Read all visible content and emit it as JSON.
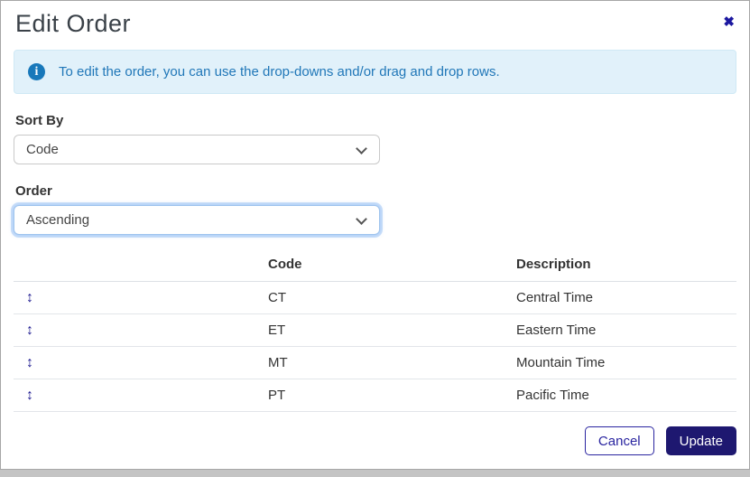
{
  "modal": {
    "title": "Edit Order",
    "close_icon": "✖"
  },
  "alert": {
    "icon": "i",
    "text": "To edit the order, you can use the drop-downs and/or drag and drop rows."
  },
  "form": {
    "sort_by": {
      "label": "Sort By",
      "value": "Code"
    },
    "order": {
      "label": "Order",
      "value": "Ascending"
    }
  },
  "table": {
    "columns": {
      "drag": "",
      "code": "Code",
      "description": "Description"
    },
    "drag_icon": "↕",
    "rows": [
      {
        "code": "CT",
        "description": "Central Time"
      },
      {
        "code": "ET",
        "description": "Eastern Time"
      },
      {
        "code": "MT",
        "description": "Mountain Time"
      },
      {
        "code": "PT",
        "description": "Pacific Time"
      }
    ]
  },
  "footer": {
    "cancel_label": "Cancel",
    "update_label": "Update"
  },
  "colors": {
    "accent_navy": "#1e1a90",
    "primary_button_bg": "#1e1870",
    "info_text": "#2077b8",
    "info_bg": "#e1f1fa",
    "info_icon_bg": "#1878ba",
    "title_text": "#3a4148",
    "backdrop": "#b4b4b4"
  }
}
